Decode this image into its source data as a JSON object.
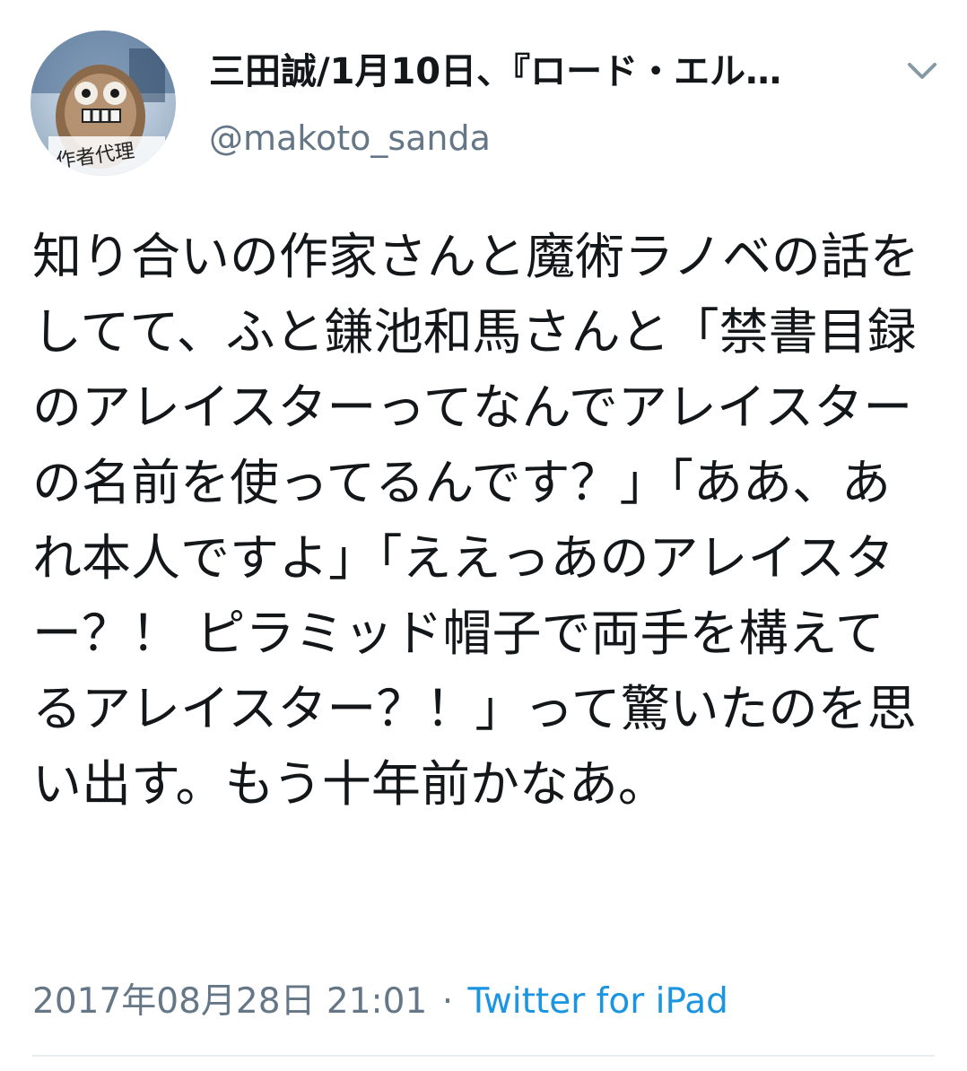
{
  "tweet": {
    "display_name": "三田誠/1月10日、『ロード・エル…",
    "handle": "@makoto_sanda",
    "avatar_caption": "作者代理",
    "text": "知り合いの作家さんと魔術ラノベの話をしてて、ふと鎌池和馬さんと「禁書目録のアレイスターってなんでアレイスターの名前を使ってるんです？」「ああ、あれ本人ですよ」「ええっあのアレイスター？！ ピラミッド帽子で両手を構えてるアレイスター？！」って驚いたのを思い出す。もう十年前かなあ。",
    "timestamp": "2017年08月28日 21:01",
    "separator": "·",
    "source": "Twitter for iPad"
  },
  "icons": {
    "caret": "chevron-down-icon"
  },
  "colors": {
    "text": "#14171a",
    "secondary": "#657786",
    "link": "#1b95e0",
    "divider": "#e6ecf0"
  }
}
